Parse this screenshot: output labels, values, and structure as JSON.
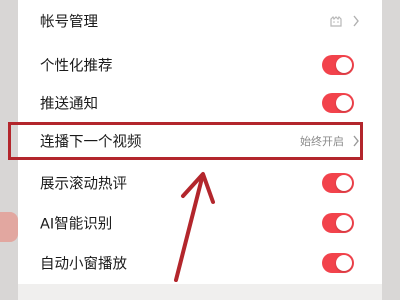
{
  "settings": {
    "rows": [
      {
        "label": "帐号管理",
        "control": "chevron",
        "icon": "account-icon"
      },
      {
        "label": "个性化推荐",
        "control": "toggle",
        "on": true
      },
      {
        "label": "推送通知",
        "control": "toggle",
        "on": true
      },
      {
        "label": "连播下一个视频",
        "control": "chevron",
        "value": "始终开启"
      },
      {
        "label": "展示滚动热评",
        "control": "toggle",
        "on": true
      },
      {
        "label": "AI智能识别",
        "control": "toggle",
        "on": true
      },
      {
        "label": "自动小窗播放",
        "control": "toggle",
        "on": true
      }
    ]
  },
  "colors": {
    "toggle_on": "#f2434c",
    "highlight": "#b3262c",
    "label_text": "#1a1a1a",
    "value_text": "#8a8a8a"
  }
}
